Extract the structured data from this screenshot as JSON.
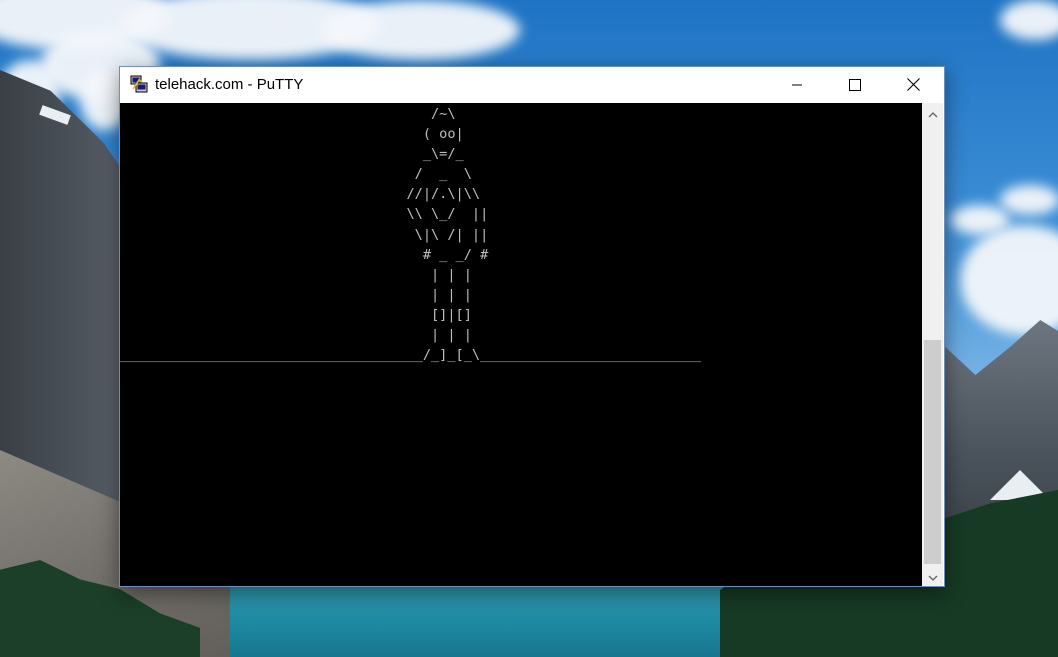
{
  "window": {
    "title": "telehack.com - PuTTY",
    "app_icon": "putty-icon",
    "controls": {
      "minimize_icon": "minimize-icon",
      "maximize_icon": "maximize-icon",
      "close_icon": "close-icon"
    }
  },
  "terminal": {
    "background": "#000000",
    "foreground": "#bfbfbf",
    "lines": [
      "                                      /~\\",
      "                                     ( oo|",
      "                                     _\\=/_",
      "                                    /  _  \\",
      "                                   //|/.\\|\\\\",
      "                                   \\\\ \\_/  ||",
      "                                    \\|\\ /| ||",
      "                                     # _ _/ #",
      "                                      | | |",
      "                                      | | |",
      "                                      []|[]",
      "                                      | | |",
      "_____________________________________/_]_[_\\___________________________"
    ]
  },
  "scrollbar": {
    "up_icon": "scroll-up-arrow-icon",
    "down_icon": "scroll-down-arrow-icon"
  }
}
